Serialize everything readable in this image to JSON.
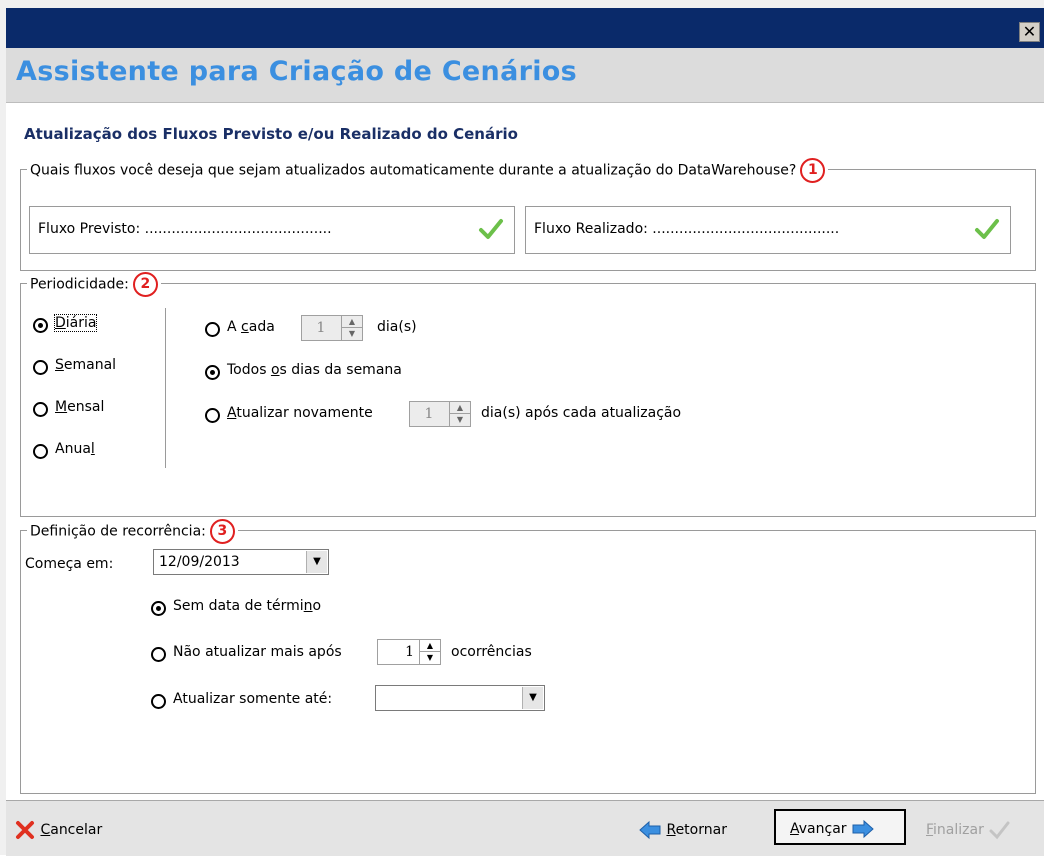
{
  "window": {
    "title": "Assistente para Criação de Cenários",
    "close_glyph": "✕"
  },
  "step": {
    "title": "Atualização dos Fluxos Previsto e/ou Realizado do Cenário"
  },
  "flows": {
    "legend": "Quais fluxos você deseja que sejam atualizados automaticamente durante a atualização do DataWarehouse?",
    "badge": "1",
    "previsto_label": "Fluxo Previsto: ..........................................",
    "realizado_label": "Fluxo Realizado: ..........................................",
    "check_color": "#6cc04a"
  },
  "periodicidade": {
    "legend": "Periodicidade:",
    "badge": "2",
    "options": [
      {
        "pre": "",
        "u": "D",
        "post": "iária",
        "selected": true
      },
      {
        "pre": "",
        "u": "S",
        "post": "emanal",
        "selected": false
      },
      {
        "pre": "",
        "u": "M",
        "post": "ensal",
        "selected": false
      },
      {
        "pre": "Anua",
        "u": "l",
        "post": "",
        "selected": false
      }
    ],
    "a_cada": {
      "pre": "A ",
      "u": "c",
      "post": "ada",
      "value": "1",
      "unit": "dia(s)",
      "selected": false
    },
    "todos_dias": {
      "pre": "Todos ",
      "u": "o",
      "post": "s dias da semana",
      "selected": true
    },
    "atualizar_novamente": {
      "pre": "",
      "u": "A",
      "post": "tualizar novamente",
      "value": "1",
      "unit": "dia(s) após cada atualização",
      "selected": false
    }
  },
  "recorrencia": {
    "legend": "Definição de recorrência:",
    "badge": "3",
    "comeca_em_label": "Começa em:",
    "comeca_em_value": "12/09/2013",
    "sem_data": {
      "pre": "Sem data de térmi",
      "u": "n",
      "post": "o",
      "selected": true
    },
    "nao_atualizar": {
      "label": "Não atualizar mais após",
      "value": "1",
      "unit": "ocorrências",
      "selected": false
    },
    "somente_ate": {
      "label": "Atualizar somente até:",
      "value": "",
      "selected": false
    }
  },
  "footer": {
    "cancel": {
      "pre": "",
      "u": "C",
      "post": "ancelar"
    },
    "back": {
      "pre": "",
      "u": "R",
      "post": "etornar"
    },
    "next": {
      "pre": "",
      "u": "A",
      "post": "vançar"
    },
    "finish": {
      "pre": "",
      "u": "F",
      "post": "inalizar"
    },
    "accent": "#3b8fe0",
    "cancel_color": "#e03020"
  }
}
